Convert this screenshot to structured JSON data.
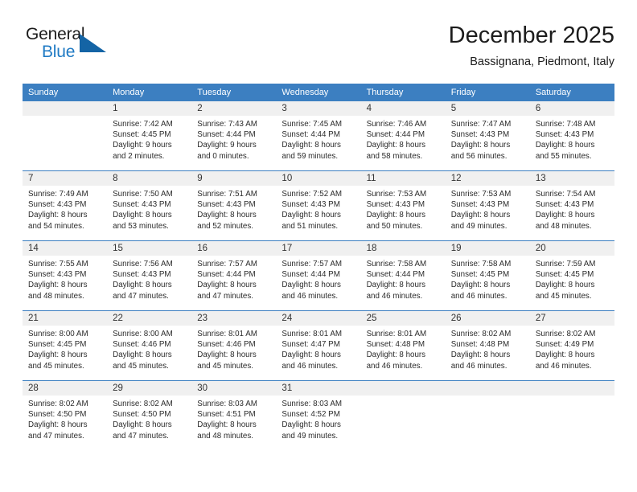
{
  "brand": {
    "name_part1": "General",
    "name_part2": "Blue",
    "logo_icon": "triangle-flag-icon",
    "accent_color": "#1464a5",
    "blue_text_color": "#1f7ac4"
  },
  "header": {
    "title": "December 2025",
    "subtitle": "Bassignana, Piedmont, Italy"
  },
  "calendar": {
    "header_bg": "#3c7fc1",
    "daynum_bg": "#f0f0f0",
    "weekday_headers": [
      "Sunday",
      "Monday",
      "Tuesday",
      "Wednesday",
      "Thursday",
      "Friday",
      "Saturday"
    ],
    "weeks": [
      [
        {
          "day": "",
          "sunrise": "",
          "sunset": "",
          "daylight_line1": "",
          "daylight_line2": ""
        },
        {
          "day": "1",
          "sunrise": "Sunrise: 7:42 AM",
          "sunset": "Sunset: 4:45 PM",
          "daylight_line1": "Daylight: 9 hours",
          "daylight_line2": "and 2 minutes."
        },
        {
          "day": "2",
          "sunrise": "Sunrise: 7:43 AM",
          "sunset": "Sunset: 4:44 PM",
          "daylight_line1": "Daylight: 9 hours",
          "daylight_line2": "and 0 minutes."
        },
        {
          "day": "3",
          "sunrise": "Sunrise: 7:45 AM",
          "sunset": "Sunset: 4:44 PM",
          "daylight_line1": "Daylight: 8 hours",
          "daylight_line2": "and 59 minutes."
        },
        {
          "day": "4",
          "sunrise": "Sunrise: 7:46 AM",
          "sunset": "Sunset: 4:44 PM",
          "daylight_line1": "Daylight: 8 hours",
          "daylight_line2": "and 58 minutes."
        },
        {
          "day": "5",
          "sunrise": "Sunrise: 7:47 AM",
          "sunset": "Sunset: 4:43 PM",
          "daylight_line1": "Daylight: 8 hours",
          "daylight_line2": "and 56 minutes."
        },
        {
          "day": "6",
          "sunrise": "Sunrise: 7:48 AM",
          "sunset": "Sunset: 4:43 PM",
          "daylight_line1": "Daylight: 8 hours",
          "daylight_line2": "and 55 minutes."
        }
      ],
      [
        {
          "day": "7",
          "sunrise": "Sunrise: 7:49 AM",
          "sunset": "Sunset: 4:43 PM",
          "daylight_line1": "Daylight: 8 hours",
          "daylight_line2": "and 54 minutes."
        },
        {
          "day": "8",
          "sunrise": "Sunrise: 7:50 AM",
          "sunset": "Sunset: 4:43 PM",
          "daylight_line1": "Daylight: 8 hours",
          "daylight_line2": "and 53 minutes."
        },
        {
          "day": "9",
          "sunrise": "Sunrise: 7:51 AM",
          "sunset": "Sunset: 4:43 PM",
          "daylight_line1": "Daylight: 8 hours",
          "daylight_line2": "and 52 minutes."
        },
        {
          "day": "10",
          "sunrise": "Sunrise: 7:52 AM",
          "sunset": "Sunset: 4:43 PM",
          "daylight_line1": "Daylight: 8 hours",
          "daylight_line2": "and 51 minutes."
        },
        {
          "day": "11",
          "sunrise": "Sunrise: 7:53 AM",
          "sunset": "Sunset: 4:43 PM",
          "daylight_line1": "Daylight: 8 hours",
          "daylight_line2": "and 50 minutes."
        },
        {
          "day": "12",
          "sunrise": "Sunrise: 7:53 AM",
          "sunset": "Sunset: 4:43 PM",
          "daylight_line1": "Daylight: 8 hours",
          "daylight_line2": "and 49 minutes."
        },
        {
          "day": "13",
          "sunrise": "Sunrise: 7:54 AM",
          "sunset": "Sunset: 4:43 PM",
          "daylight_line1": "Daylight: 8 hours",
          "daylight_line2": "and 48 minutes."
        }
      ],
      [
        {
          "day": "14",
          "sunrise": "Sunrise: 7:55 AM",
          "sunset": "Sunset: 4:43 PM",
          "daylight_line1": "Daylight: 8 hours",
          "daylight_line2": "and 48 minutes."
        },
        {
          "day": "15",
          "sunrise": "Sunrise: 7:56 AM",
          "sunset": "Sunset: 4:43 PM",
          "daylight_line1": "Daylight: 8 hours",
          "daylight_line2": "and 47 minutes."
        },
        {
          "day": "16",
          "sunrise": "Sunrise: 7:57 AM",
          "sunset": "Sunset: 4:44 PM",
          "daylight_line1": "Daylight: 8 hours",
          "daylight_line2": "and 47 minutes."
        },
        {
          "day": "17",
          "sunrise": "Sunrise: 7:57 AM",
          "sunset": "Sunset: 4:44 PM",
          "daylight_line1": "Daylight: 8 hours",
          "daylight_line2": "and 46 minutes."
        },
        {
          "day": "18",
          "sunrise": "Sunrise: 7:58 AM",
          "sunset": "Sunset: 4:44 PM",
          "daylight_line1": "Daylight: 8 hours",
          "daylight_line2": "and 46 minutes."
        },
        {
          "day": "19",
          "sunrise": "Sunrise: 7:58 AM",
          "sunset": "Sunset: 4:45 PM",
          "daylight_line1": "Daylight: 8 hours",
          "daylight_line2": "and 46 minutes."
        },
        {
          "day": "20",
          "sunrise": "Sunrise: 7:59 AM",
          "sunset": "Sunset: 4:45 PM",
          "daylight_line1": "Daylight: 8 hours",
          "daylight_line2": "and 45 minutes."
        }
      ],
      [
        {
          "day": "21",
          "sunrise": "Sunrise: 8:00 AM",
          "sunset": "Sunset: 4:45 PM",
          "daylight_line1": "Daylight: 8 hours",
          "daylight_line2": "and 45 minutes."
        },
        {
          "day": "22",
          "sunrise": "Sunrise: 8:00 AM",
          "sunset": "Sunset: 4:46 PM",
          "daylight_line1": "Daylight: 8 hours",
          "daylight_line2": "and 45 minutes."
        },
        {
          "day": "23",
          "sunrise": "Sunrise: 8:01 AM",
          "sunset": "Sunset: 4:46 PM",
          "daylight_line1": "Daylight: 8 hours",
          "daylight_line2": "and 45 minutes."
        },
        {
          "day": "24",
          "sunrise": "Sunrise: 8:01 AM",
          "sunset": "Sunset: 4:47 PM",
          "daylight_line1": "Daylight: 8 hours",
          "daylight_line2": "and 46 minutes."
        },
        {
          "day": "25",
          "sunrise": "Sunrise: 8:01 AM",
          "sunset": "Sunset: 4:48 PM",
          "daylight_line1": "Daylight: 8 hours",
          "daylight_line2": "and 46 minutes."
        },
        {
          "day": "26",
          "sunrise": "Sunrise: 8:02 AM",
          "sunset": "Sunset: 4:48 PM",
          "daylight_line1": "Daylight: 8 hours",
          "daylight_line2": "and 46 minutes."
        },
        {
          "day": "27",
          "sunrise": "Sunrise: 8:02 AM",
          "sunset": "Sunset: 4:49 PM",
          "daylight_line1": "Daylight: 8 hours",
          "daylight_line2": "and 46 minutes."
        }
      ],
      [
        {
          "day": "28",
          "sunrise": "Sunrise: 8:02 AM",
          "sunset": "Sunset: 4:50 PM",
          "daylight_line1": "Daylight: 8 hours",
          "daylight_line2": "and 47 minutes."
        },
        {
          "day": "29",
          "sunrise": "Sunrise: 8:02 AM",
          "sunset": "Sunset: 4:50 PM",
          "daylight_line1": "Daylight: 8 hours",
          "daylight_line2": "and 47 minutes."
        },
        {
          "day": "30",
          "sunrise": "Sunrise: 8:03 AM",
          "sunset": "Sunset: 4:51 PM",
          "daylight_line1": "Daylight: 8 hours",
          "daylight_line2": "and 48 minutes."
        },
        {
          "day": "31",
          "sunrise": "Sunrise: 8:03 AM",
          "sunset": "Sunset: 4:52 PM",
          "daylight_line1": "Daylight: 8 hours",
          "daylight_line2": "and 49 minutes."
        },
        {
          "day": "",
          "sunrise": "",
          "sunset": "",
          "daylight_line1": "",
          "daylight_line2": ""
        },
        {
          "day": "",
          "sunrise": "",
          "sunset": "",
          "daylight_line1": "",
          "daylight_line2": ""
        },
        {
          "day": "",
          "sunrise": "",
          "sunset": "",
          "daylight_line1": "",
          "daylight_line2": ""
        }
      ]
    ]
  }
}
